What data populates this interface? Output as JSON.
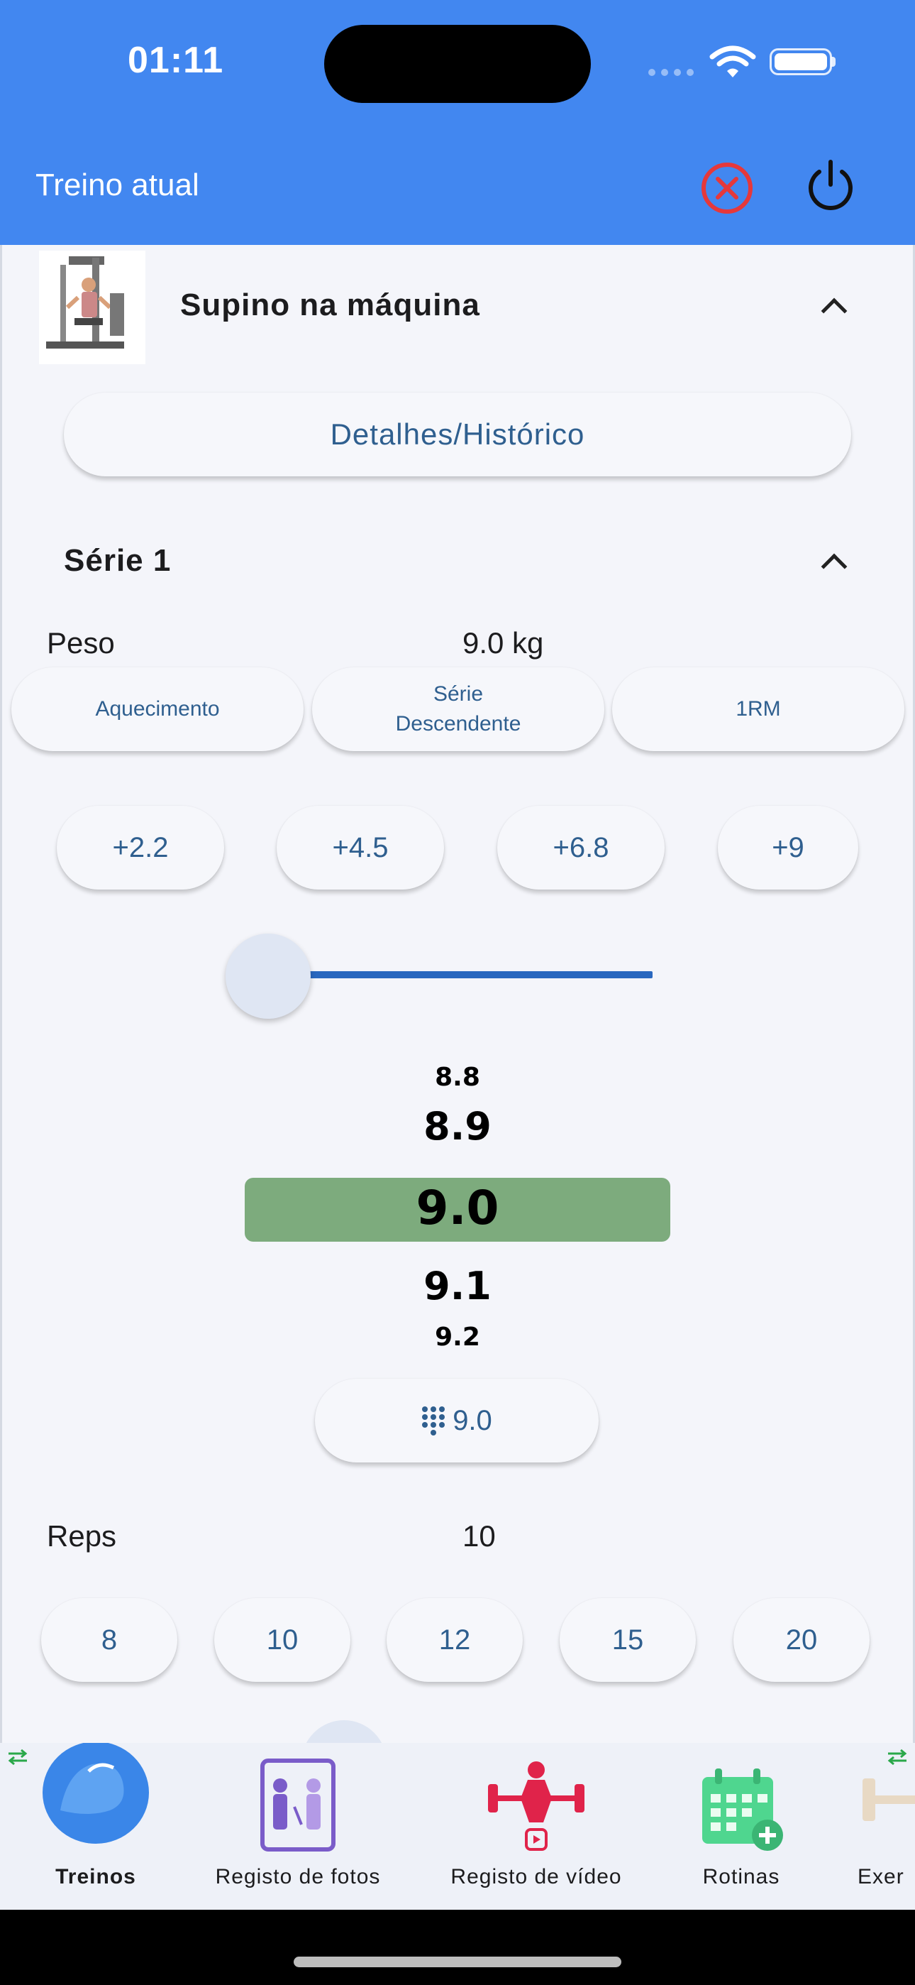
{
  "status_bar": {
    "time": "01:11"
  },
  "header": {
    "title": "Treino atual"
  },
  "exercise": {
    "name": "Supino na máquina",
    "details_button": "Detalhes/Histórico"
  },
  "set": {
    "title": "Série 1",
    "weight_label": "Peso",
    "weight_value": "9.0 kg",
    "tags": [
      "Aquecimento",
      "Série",
      "Descendente",
      "1RM"
    ],
    "increments": [
      "+2.2",
      "+4.5",
      "+6.8",
      "+9"
    ],
    "wheel": [
      "8.8",
      "8.9",
      "9.0",
      "9.1",
      "9.2"
    ],
    "keypad_value": "9.0",
    "reps_label": "Reps",
    "reps_value": "10",
    "rep_options": [
      "8",
      "10",
      "12",
      "15",
      "20"
    ]
  },
  "nav": {
    "items": [
      "Treinos",
      "Registo de fotos",
      "Registo de vídeo",
      "Rotinas",
      "Exer"
    ]
  },
  "colors": {
    "header_bg": "#4287f0",
    "selected_value_bg": "#7dab7d",
    "slider_track": "#2a68bf",
    "cancel_red": "#e5383b",
    "accent_text": "#2f5f8f"
  }
}
